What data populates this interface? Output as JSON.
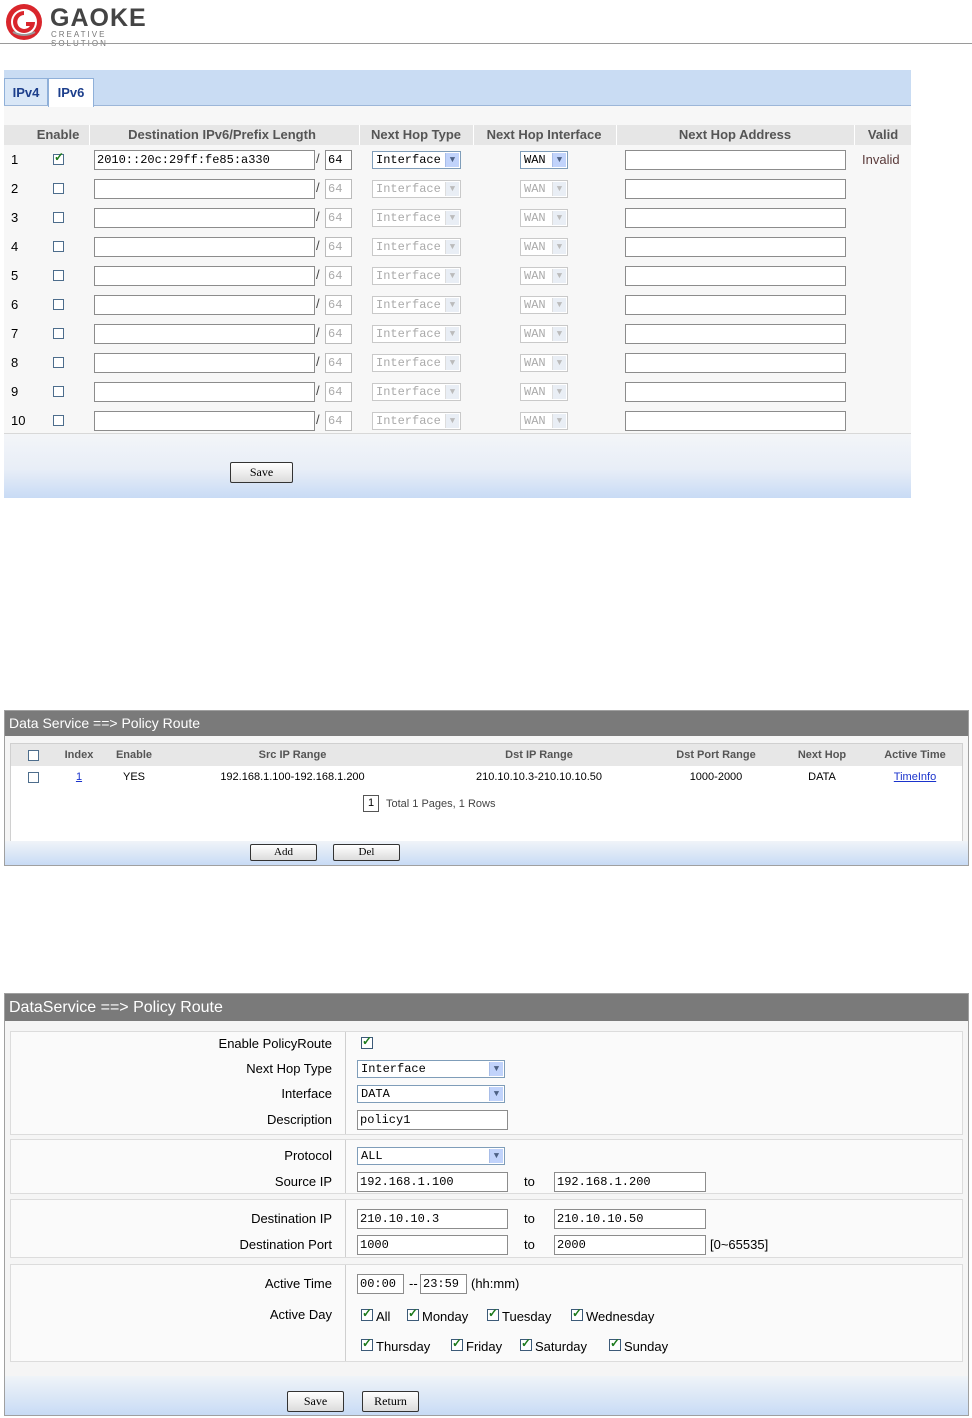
{
  "brand": {
    "name": "GAOKE",
    "tagline": "CREATIVE SOLUTION",
    "accent": "#d9262c"
  },
  "ipv6_static": {
    "tabs": [
      "IPv4",
      "IPv6"
    ],
    "columns": [
      "Enable",
      "Destination IPv6/Prefix Length",
      "Next Hop Type",
      "Next Hop Interface",
      "Next Hop Address",
      "Valid"
    ],
    "slash": "/",
    "rows": [
      {
        "num": "1",
        "enabled": true,
        "dest": "2010::20c:29ff:fe85:a330",
        "prefix": "64",
        "type": "Interface",
        "iface": "WAN",
        "addr": "",
        "valid": "Invalid",
        "disabled": false
      },
      {
        "num": "2",
        "enabled": false,
        "dest": "",
        "prefix": "64",
        "type": "Interface",
        "iface": "WAN",
        "addr": "",
        "valid": "",
        "disabled": true
      },
      {
        "num": "3",
        "enabled": false,
        "dest": "",
        "prefix": "64",
        "type": "Interface",
        "iface": "WAN",
        "addr": "",
        "valid": "",
        "disabled": true
      },
      {
        "num": "4",
        "enabled": false,
        "dest": "",
        "prefix": "64",
        "type": "Interface",
        "iface": "WAN",
        "addr": "",
        "valid": "",
        "disabled": true
      },
      {
        "num": "5",
        "enabled": false,
        "dest": "",
        "prefix": "64",
        "type": "Interface",
        "iface": "WAN",
        "addr": "",
        "valid": "",
        "disabled": true
      },
      {
        "num": "6",
        "enabled": false,
        "dest": "",
        "prefix": "64",
        "type": "Interface",
        "iface": "WAN",
        "addr": "",
        "valid": "",
        "disabled": true
      },
      {
        "num": "7",
        "enabled": false,
        "dest": "",
        "prefix": "64",
        "type": "Interface",
        "iface": "WAN",
        "addr": "",
        "valid": "",
        "disabled": true
      },
      {
        "num": "8",
        "enabled": false,
        "dest": "",
        "prefix": "64",
        "type": "Interface",
        "iface": "WAN",
        "addr": "",
        "valid": "",
        "disabled": true
      },
      {
        "num": "9",
        "enabled": false,
        "dest": "",
        "prefix": "64",
        "type": "Interface",
        "iface": "WAN",
        "addr": "",
        "valid": "",
        "disabled": true
      },
      {
        "num": "10",
        "enabled": false,
        "dest": "",
        "prefix": "64",
        "type": "Interface",
        "iface": "WAN",
        "addr": "",
        "valid": "",
        "disabled": true
      }
    ],
    "save_label": "Save"
  },
  "policy_list": {
    "title": "Data Service ==> Policy Route",
    "columns": [
      "Index",
      "Enable",
      "Src IP Range",
      "Dst IP Range",
      "Dst Port Range",
      "Next Hop",
      "Active Time"
    ],
    "rows": [
      {
        "index": "1",
        "enable": "YES",
        "src": "192.168.1.100-192.168.1.200",
        "dst": "210.10.10.3-210.10.10.50",
        "port": "1000-2000",
        "hop": "DATA",
        "time": "TimeInfo"
      }
    ],
    "page": "1",
    "pager_text": "Total 1 Pages, 1 Rows",
    "add_label": "Add",
    "del_label": "Del"
  },
  "policy_edit": {
    "title": "DataService ==> Policy Route",
    "enable_label": "Enable PolicyRoute",
    "nexthop_label": "Next Hop Type",
    "nexthop_value": "Interface",
    "interface_label": "Interface",
    "interface_value": "DATA",
    "desc_label": "Description",
    "desc_value": "policy1",
    "protocol_label": "Protocol",
    "protocol_value": "ALL",
    "src_label": "Source IP",
    "src_from": "192.168.1.100",
    "src_to": "192.168.1.200",
    "dst_label": "Destination IP",
    "dst_from": "210.10.10.3",
    "dst_to": "210.10.10.50",
    "port_label": "Destination Port",
    "port_from": "1000",
    "port_to": "2000",
    "port_range": "[0~65535]",
    "to": "to",
    "time_label": "Active Time",
    "time_from": "00:00",
    "time_sep": "--",
    "time_to": "23:59",
    "time_hint": "(hh:mm)",
    "day_label": "Active Day",
    "days": [
      "All",
      "Monday",
      "Tuesday",
      "Wednesday",
      "Thursday",
      "Friday",
      "Saturday",
      "Sunday"
    ],
    "save_label": "Save",
    "return_label": "Return"
  }
}
